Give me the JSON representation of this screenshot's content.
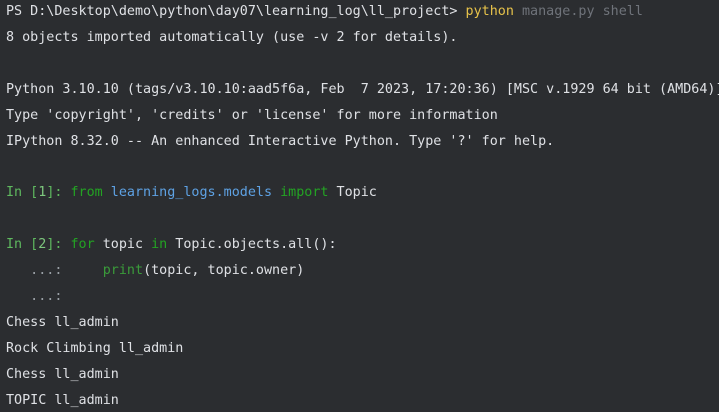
{
  "terminal": {
    "ps_prompt": "PS D:\\Desktop\\demo\\python\\day07\\learning_log\\ll_project> ",
    "ps_command": "python",
    "ps_args": " manage.py shell",
    "imported_msg": "8 objects imported automatically (use -v 2 for details).",
    "python_version": "Python 3.10.10 (tags/v3.10.10:aad5f6a, Feb  7 2023, 17:20:36) [MSC v.1929 64 bit (AMD64)]",
    "type_info": "Type 'copyright', 'credits' or 'license' for more information",
    "ipython_info": "IPython 8.32.0 -- An enhanced Interactive Python. Type '?' for help.",
    "in1": {
      "prompt_open": "In [",
      "number": "1",
      "prompt_close": "]: ",
      "kw_from": "from",
      "module": " learning_logs.models",
      "kw_import": " import",
      "name": " Topic"
    },
    "in2": {
      "prompt_open": "In [",
      "number": "2",
      "prompt_close": "]: ",
      "kw_for": "for",
      "var": " topic",
      "kw_in": " in",
      "expr": " Topic.objects.all():"
    },
    "cont1": {
      "prompt": "   ...:     ",
      "builtin": "print",
      "args": "(topic, topic.owner)"
    },
    "cont2": {
      "prompt": "   ...: "
    },
    "output": [
      "Chess ll_admin",
      "Rock Climbing ll_admin",
      "Chess ll_admin",
      "TOPIC ll_admin"
    ],
    "colors": {
      "background": "#2b2d30",
      "text": "#dfe1e5",
      "command": "#e6c24a",
      "dim": "#6f737a",
      "keyword": "#23a323",
      "module": "#5ea2e4"
    }
  }
}
